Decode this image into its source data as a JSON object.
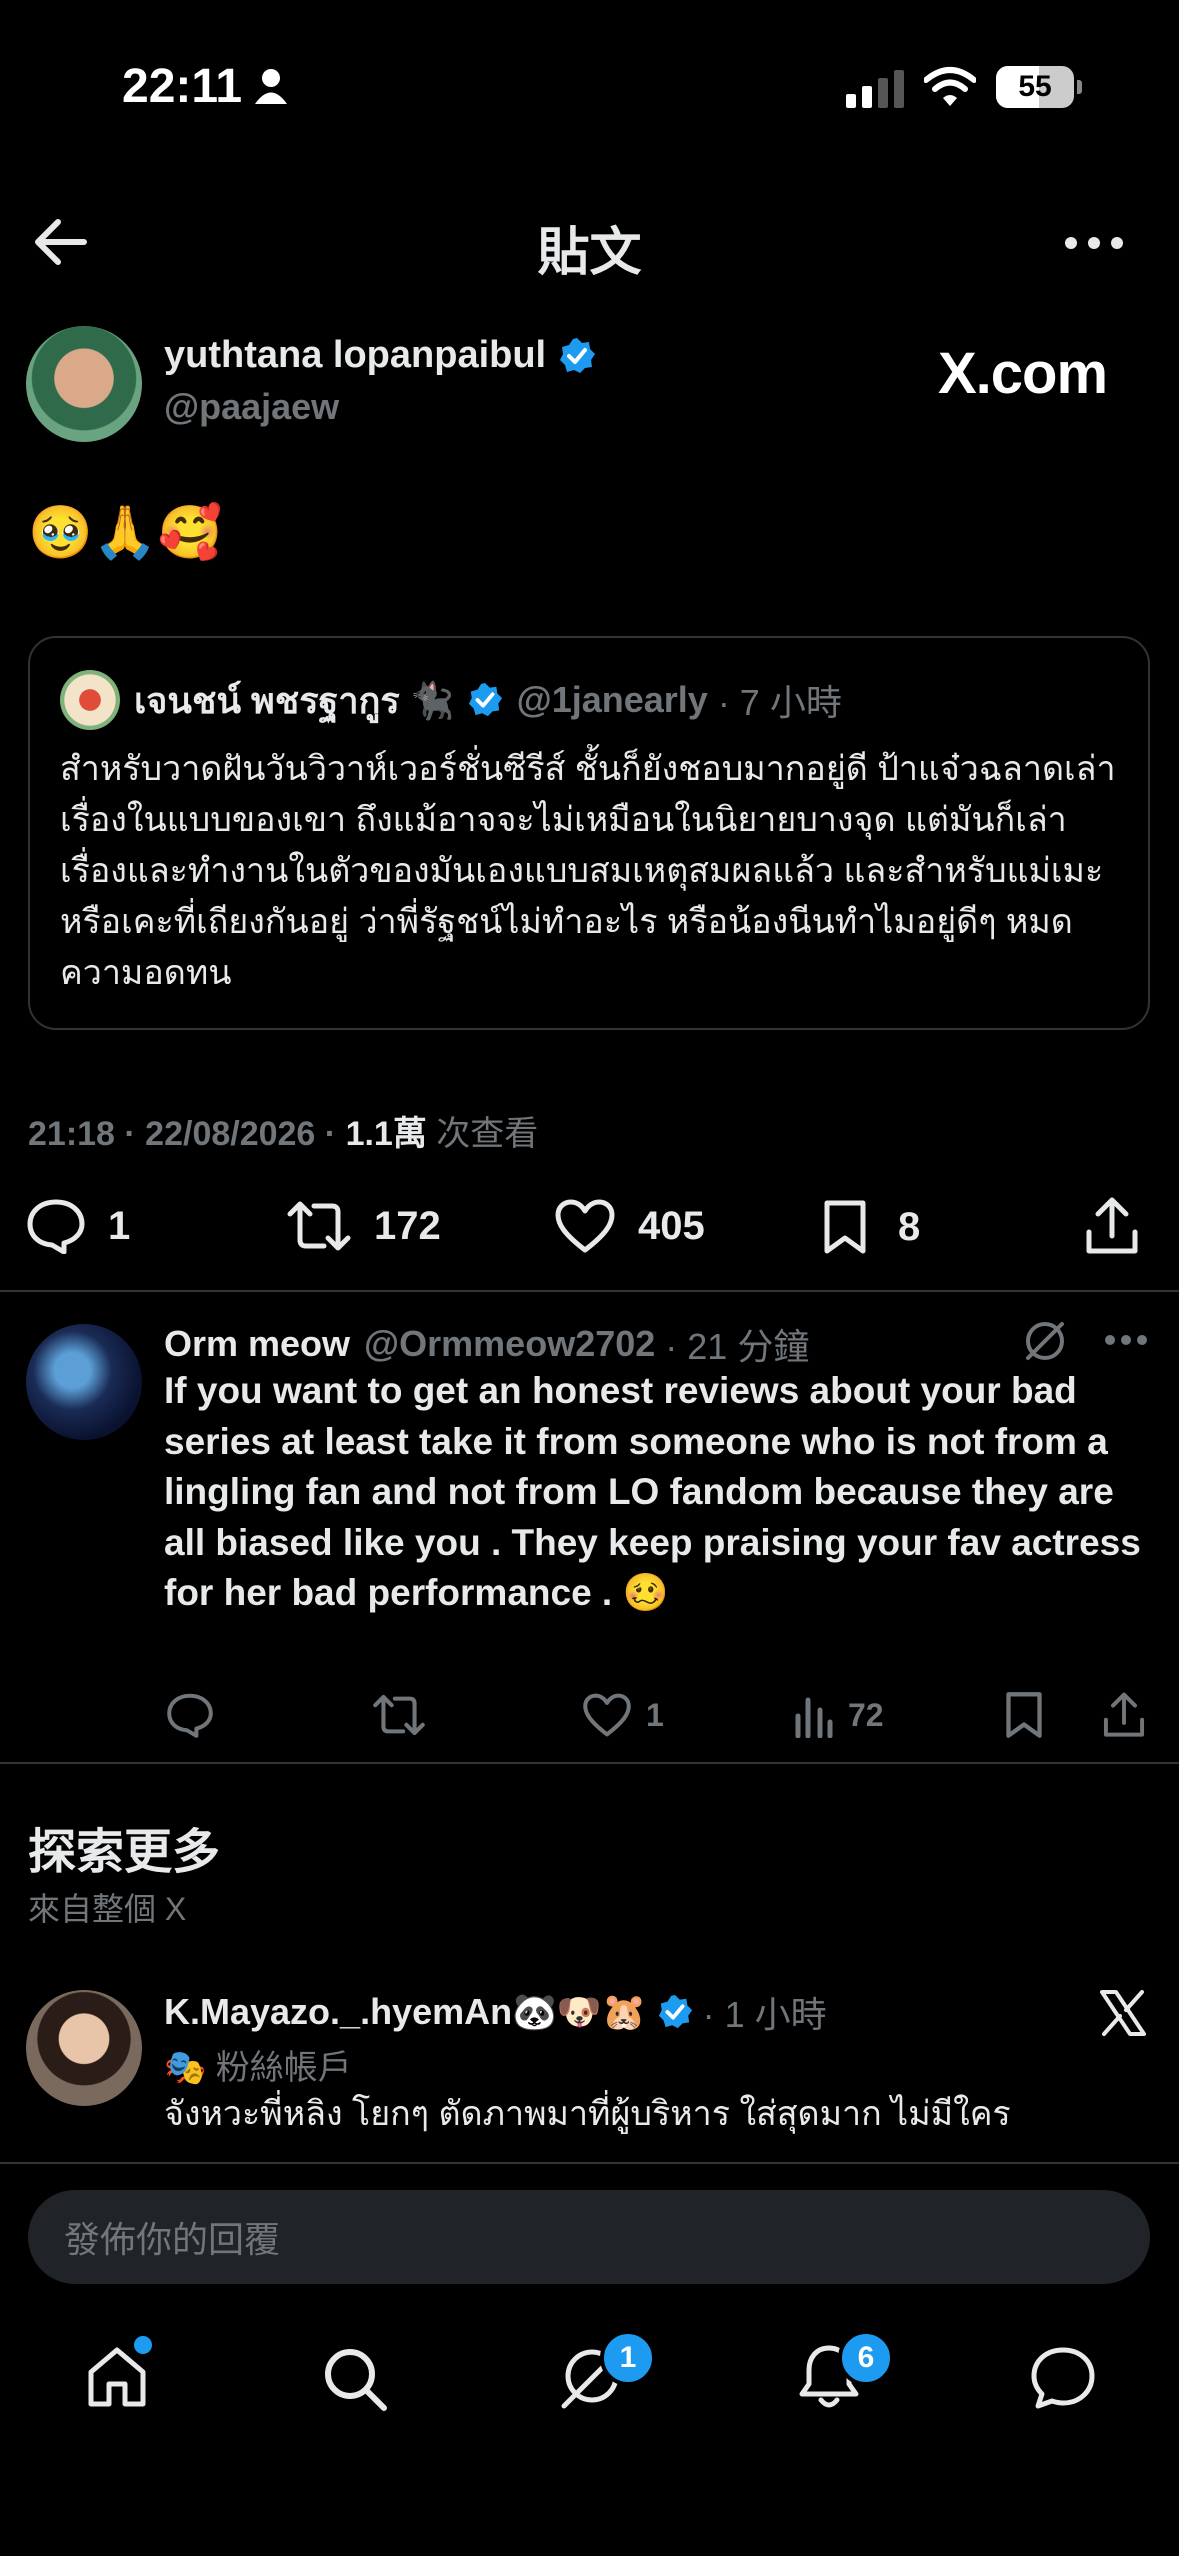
{
  "status_bar": {
    "time": "22:11",
    "battery": "55"
  },
  "header": {
    "title": "貼文"
  },
  "post": {
    "author_name": "yuthtana lopanpaibul",
    "handle": "@paajaew",
    "brand": "X.com",
    "body": "🥹🙏🥰",
    "quote": {
      "author_name": "เจนชน์ พชรฐากูร 🐈‍⬛",
      "handle": "@1janearly",
      "time": "· 7 小時",
      "text": "สำหรับวาดฝันวันวิวาห์เวอร์ชั่นซีรีส์ ชั้นก็ยังชอบมากอยู่ดี ป้าแจ๋วฉลาดเล่าเรื่องในแบบของเขา ถึงแม้อาจจะไม่เหมือนในนิยายบางจุด แต่มันก็เล่าเรื่องและทำงานในตัวของมันเองแบบสมเหตุสมผลแล้ว และสำหรับแม่เมะหรือเคะที่เถียงกันอยู่ ว่าพี่รัฐชน์ไม่ทำอะไร หรือน้องนีนทำไมอยู่ดีๆ หมดความอดทน"
    },
    "timestamp": "21:18 · 22/08/2026 · ",
    "views_count": "1.1萬",
    "views_label": " 次查看",
    "stats": {
      "replies": "1",
      "reposts": "172",
      "likes": "405",
      "bookmarks": "8"
    }
  },
  "reply": {
    "author_name": "Orm meow",
    "handle": "@Ormmeow2702",
    "time": "· 21 分鐘",
    "text": "If you want to get an honest reviews about your bad series at least take it from someone who is not from a lingling fan and not from LO fandom because  they are all biased like you . They keep praising your fav actress for her bad performance . 🥴",
    "stats": {
      "likes": "1",
      "views": "72"
    }
  },
  "explore": {
    "title": "探索更多",
    "subtitle": "來自整個 X",
    "item": {
      "author_name": "K.Mayazo._.hyemAn🐼🐶🐹",
      "time": "· 1 小時",
      "tag": "🎭 粉絲帳戶",
      "text": "จังหวะพี่หลิง โยกๆ ตัดภาพมาที่ผู้บริหาร ใส่สุดมาก ไม่มีใคร"
    }
  },
  "composer": {
    "placeholder": "發佈你的回覆"
  },
  "tab_bar": {
    "messages_badge": "1",
    "notifications_badge": "6"
  },
  "colors": {
    "verified": "#1d9bf0",
    "background": "#000000",
    "muted": "#71767b"
  }
}
